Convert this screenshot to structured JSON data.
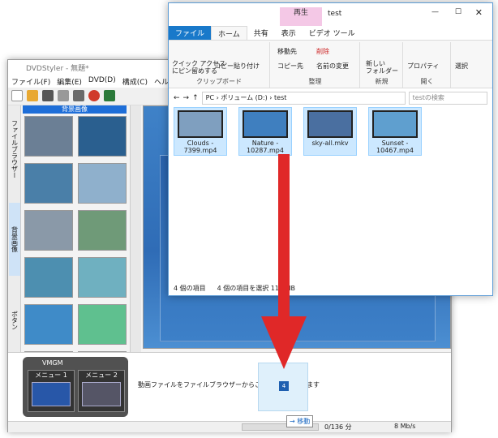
{
  "dvdstyler": {
    "title": "DVDStyler - 無題*",
    "menu": [
      "ファイル(F)",
      "編集(E)",
      "DVD(D)",
      "構成(C)",
      "ヘルプ(H)"
    ],
    "bg_header": "背景画像",
    "side_tabs": [
      "ファイルブラウザー",
      "背景画像",
      "ボタン"
    ],
    "vmgm_label": "VMGM",
    "menu1": "メニュー 1",
    "menu2": "メニュー 2",
    "drop_hint": "動画ファイルをファイルブラウザーからここにドラッグします",
    "drag_count": "4",
    "drag_tip": "→ 移動",
    "status_size": "0/136 分",
    "status_rate": "8 Mb/s",
    "thumb_colors": [
      "#6b7f95",
      "#2a5f8f",
      "#4a7fa8",
      "#8fb0cc",
      "#8a99a8",
      "#6f9a78",
      "#4d8fb0",
      "#6fb0c0",
      "#3f8bc8",
      "#5fc08f",
      "#9ab8d0",
      "#888"
    ]
  },
  "explorer": {
    "title": "test",
    "context_tab": "再生",
    "tabs": [
      "ファイル",
      "ホーム",
      "共有",
      "表示",
      "ビデオ ツール"
    ],
    "clipboard": {
      "pin": "クイック アクセス\nにピン留めする",
      "copy": "コピー",
      "paste": "貼り付け",
      "label": "クリップボード"
    },
    "organize": {
      "move": "移動先",
      "delete": "削除",
      "copyto": "コピー先",
      "rename": "名前の変更",
      "label": "整理"
    },
    "new": {
      "folder": "新しい\nフォルダー",
      "label": "新規"
    },
    "open": {
      "props": "プロパティ",
      "label": "開く"
    },
    "select": {
      "label": "選択"
    },
    "path": "PC › ボリューム (D:) › test",
    "search": "testの検索",
    "files": [
      {
        "name": "Clouds -\n7399.mp4",
        "color": "#7f9fbf"
      },
      {
        "name": "Nature -\n10287.mp4",
        "color": "#3f7fbf"
      },
      {
        "name": "sky-all.mkv",
        "color": "#4a6fa0"
      },
      {
        "name": "Sunset -\n10467.mp4",
        "color": "#5f9fcf"
      }
    ],
    "status_items": "4 個の項目",
    "status_selected": "4 個の項目を選択  111 MB"
  }
}
